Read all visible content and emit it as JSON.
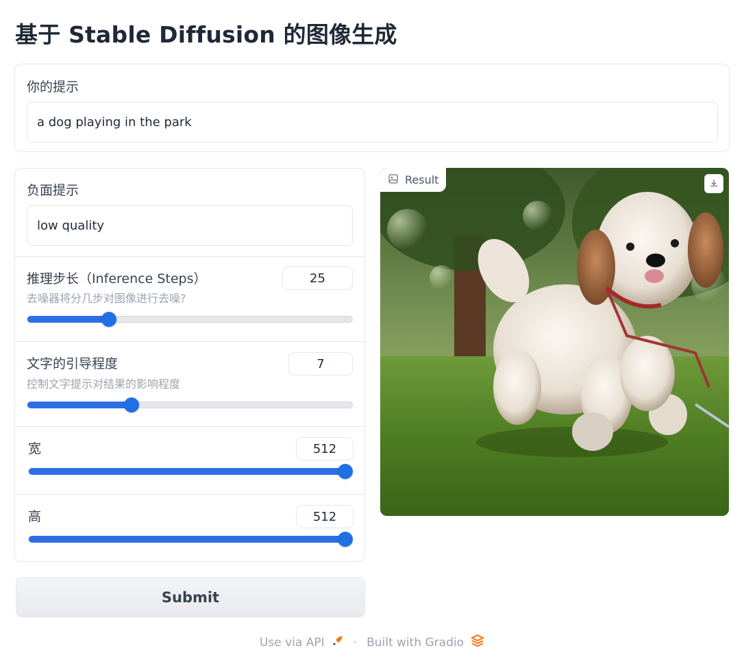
{
  "title": "基于 Stable Diffusion 的图像生成",
  "prompt": {
    "label": "你的提示",
    "value": "a dog playing in the park"
  },
  "negative_prompt": {
    "label": "负面提示",
    "value": "low quality"
  },
  "steps": {
    "label": "推理步长（Inference Steps）",
    "info": "去噪器将分几步对图像进行去噪?",
    "value": "25",
    "fraction": 0.25
  },
  "guidance": {
    "label": "文字的引导程度",
    "info": "控制文字提示对结果的影响程度",
    "value": "7",
    "fraction": 0.32
  },
  "width": {
    "label": "宽",
    "value": "512",
    "fraction": 1.0
  },
  "height": {
    "label": "高",
    "value": "512",
    "fraction": 1.0
  },
  "result": {
    "label": "Result",
    "image_icon": "image-icon",
    "download_icon": "download-icon"
  },
  "submit_label": "Submit",
  "footer": {
    "api": "Use via API",
    "separator": "·",
    "built": "Built with Gradio"
  },
  "colors": {
    "accent": "#2f6fe4",
    "gradio": "#f97316"
  }
}
